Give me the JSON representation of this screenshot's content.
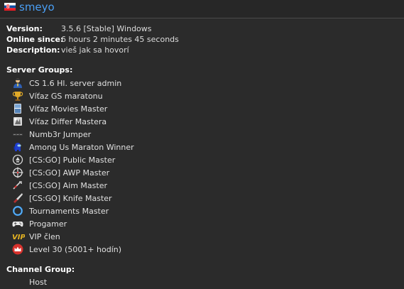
{
  "client": {
    "nickname": "smeyo",
    "flag_icon": "slovakia-flag"
  },
  "info": {
    "version_label": "Version:",
    "version_value": "3.5.6 [Stable] Windows",
    "online_label": "Online since:",
    "online_value": "6 hours 2 minutes 45 seconds",
    "description_label": "Description:",
    "description_value": "vieš jak sa hovorí"
  },
  "server_groups": {
    "title": "Server Groups:",
    "items": [
      {
        "label": "CS 1.6  Hl. server admin",
        "icon": "admin-person-icon"
      },
      {
        "label": "Víťaz GS maratonu",
        "icon": "trophy-icon"
      },
      {
        "label": "Víťaz Movies Master",
        "icon": "movie-icon"
      },
      {
        "label": "Víťaz Differ Mastera",
        "icon": "differ-icon"
      },
      {
        "label": "Numb3r Jumper",
        "icon": "jumper-icon"
      },
      {
        "label": "Among Us Maraton Winner",
        "icon": "among-us-icon"
      },
      {
        "label": "[CS:GO] Public Master",
        "icon": "public-master-icon"
      },
      {
        "label": "[CS:GO] AWP Master",
        "icon": "crosshair-icon"
      },
      {
        "label": "[CS:GO] Aim Master",
        "icon": "aim-icon"
      },
      {
        "label": "[CS:GO] Knife Master",
        "icon": "knife-icon"
      },
      {
        "label": "Tournaments Master",
        "icon": "ring-icon"
      },
      {
        "label": "Progamer",
        "icon": "gamepad-icon"
      },
      {
        "label": "VIP člen",
        "icon": "vip-icon"
      },
      {
        "label": "Level 30 (5001+ hodín)",
        "icon": "crown-icon"
      }
    ]
  },
  "channel_group": {
    "title": "Channel Group:",
    "value": "Host"
  },
  "colors": {
    "background": "#2b2b2b",
    "nickname": "#4a9ff5",
    "text": "#e6e6e6"
  }
}
